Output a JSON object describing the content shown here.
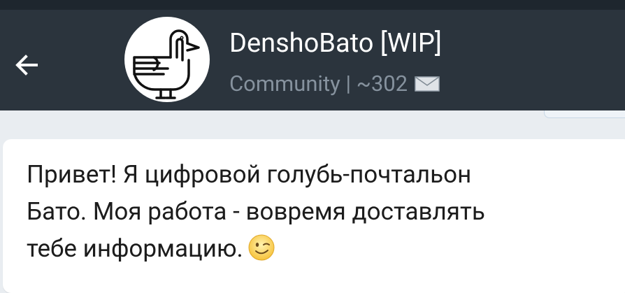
{
  "header": {
    "back_icon": "arrow-left-icon",
    "avatar_icon": "pigeon-logo-icon",
    "title": "DenshoBato [WIP]",
    "subtitle": "Community | ~302",
    "subtitle_icon": "envelope-icon",
    "background": "#2b343d"
  },
  "message": {
    "lines": [
      "Привет! Я цифровой голубь-почтальон",
      "Бато. Моя работа - вовремя доставлять",
      "тебе информацию."
    ],
    "emoji": "winking-face-icon"
  }
}
